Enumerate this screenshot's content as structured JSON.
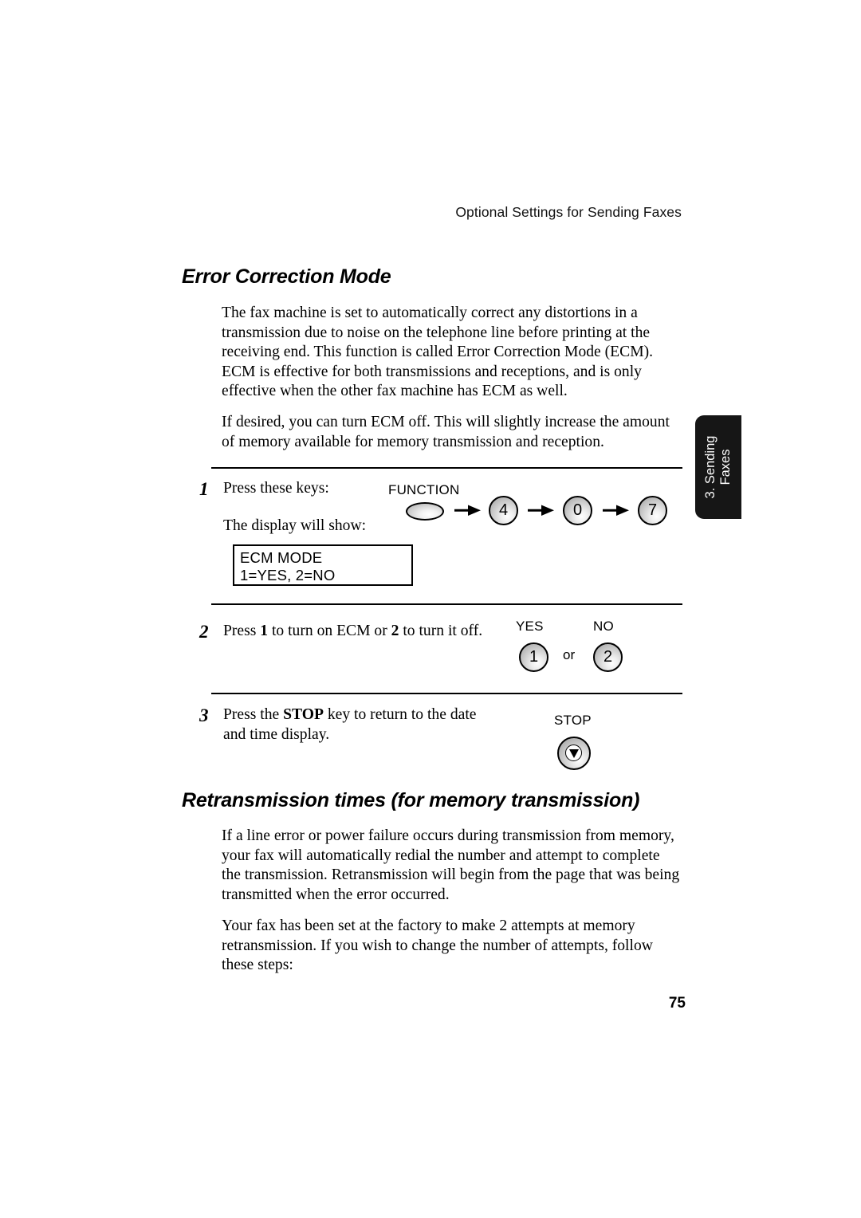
{
  "page": {
    "running_header": "Optional Settings for Sending Faxes",
    "page_number": "75"
  },
  "side_tab": {
    "line1": "3. Sending",
    "line2": "Faxes"
  },
  "sections": [
    {
      "heading": "Error Correction Mode",
      "paragraphs": [
        "The fax machine is set to automatically correct any distortions in a transmission due to noise on the telephone line before printing at the receiving end. This function is called Error Correction Mode (ECM). ECM is effective for both transmissions and receptions, and is only effective when the other fax machine has ECM as well.",
        "If desired, you can turn ECM off. This will slightly increase the amount of memory available for memory transmission and reception."
      ]
    },
    {
      "heading": "Retransmission times (for memory transmission)",
      "paragraphs": [
        "If a line error or power failure occurs during transmission from memory, your fax will automatically redial the number and attempt to complete the transmission. Retransmission will begin from the page that was being transmitted when the error occurred.",
        "Your fax has been set at the factory to make 2 attempts at memory retransmission. If you wish to change the number of attempts, follow these steps:"
      ]
    }
  ],
  "steps": [
    {
      "number": "1",
      "text": "Press these keys:",
      "text2": "The display will show:",
      "keys": {
        "function_label": "FUNCTION",
        "digits": [
          "4",
          "0",
          "7"
        ]
      },
      "lcd": {
        "line1": "ECM MODE",
        "line2": "1=YES, 2=NO"
      }
    },
    {
      "number": "2",
      "text_pre": "Press ",
      "text_b1": "1",
      "text_mid": " to turn on ECM or ",
      "text_b2": "2",
      "text_post": " to turn it off.",
      "yes_label": "YES",
      "no_label": "NO",
      "yes_key": "1",
      "no_key": "2",
      "or_label": "or"
    },
    {
      "number": "3",
      "text_pre": "Press the ",
      "text_b1": "STOP",
      "text_post": " key to return to the date and time display.",
      "stop_label": "STOP"
    }
  ]
}
